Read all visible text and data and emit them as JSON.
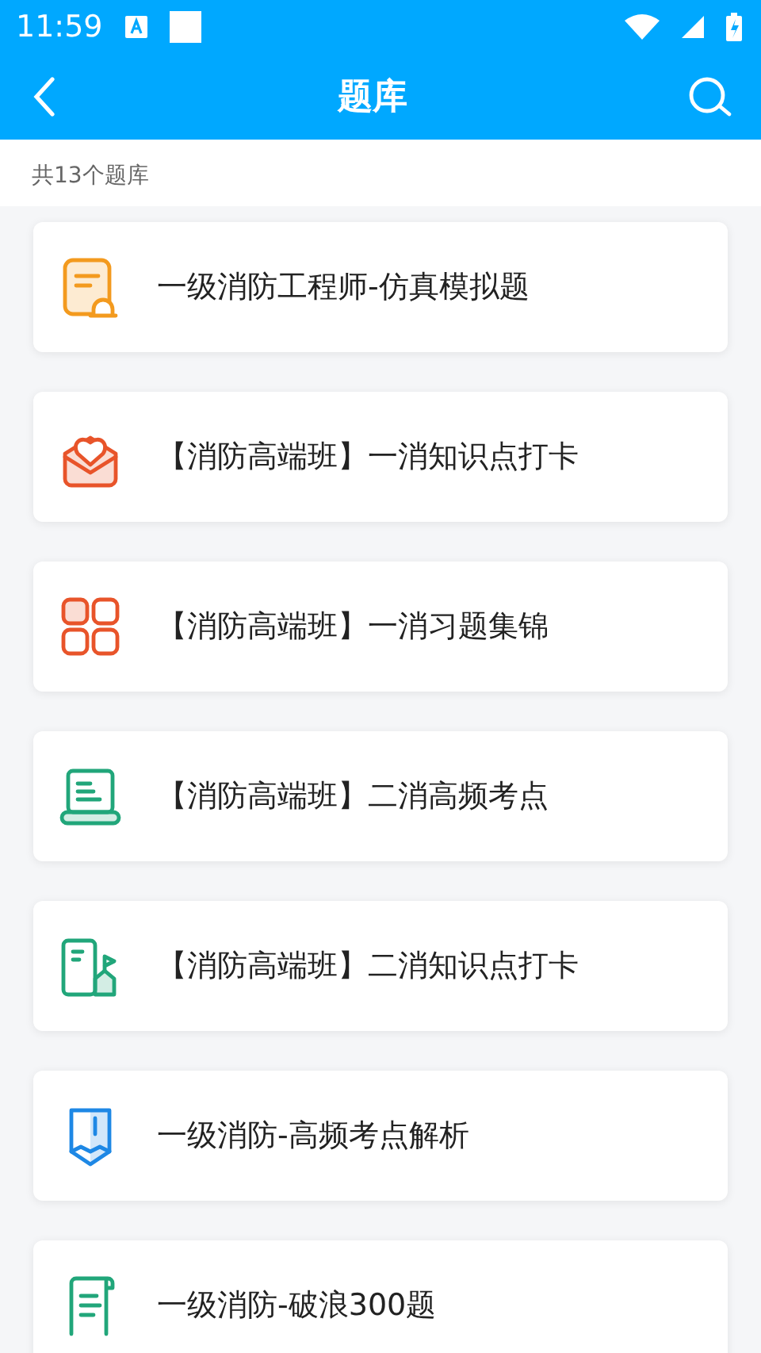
{
  "status_bar": {
    "time": "11:59"
  },
  "header": {
    "title": "题库"
  },
  "summary": "共13个题库",
  "banks": [
    {
      "title": "一级消防工程师-仿真模拟题",
      "kind": "document",
      "color": "#f39a1e"
    },
    {
      "title": "【消防高端班】一消知识点打卡",
      "kind": "envelope",
      "color": "#e8542a"
    },
    {
      "title": "【消防高端班】一消习题集锦",
      "kind": "grid",
      "color": "#e8542a"
    },
    {
      "title": "【消防高端班】二消高频考点",
      "kind": "laptop",
      "color": "#21a67a"
    },
    {
      "title": "【消防高端班】二消知识点打卡",
      "kind": "building",
      "color": "#21a67a"
    },
    {
      "title": "一级消防-高频考点解析",
      "kind": "pencil",
      "color": "#1e88e5"
    },
    {
      "title": "一级消防-破浪300题",
      "kind": "scroll",
      "color": "#21a67a"
    }
  ]
}
